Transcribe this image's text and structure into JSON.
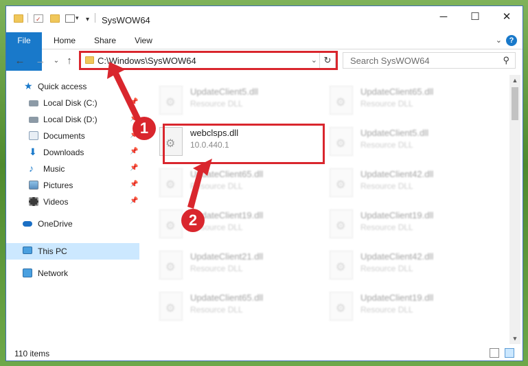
{
  "window": {
    "title": "SysWOW64"
  },
  "ribbon": {
    "tabs": [
      "File",
      "Home",
      "Share",
      "View"
    ],
    "help": "?"
  },
  "address": {
    "path": "C:\\Windows\\SysWOW64"
  },
  "search": {
    "placeholder": "Search SysWOW64"
  },
  "sidebar": {
    "items": [
      {
        "label": "Quick access",
        "pinned": false
      },
      {
        "label": "Local Disk (C:)",
        "pinned": true
      },
      {
        "label": "Local Disk (D:)",
        "pinned": true
      },
      {
        "label": "Documents",
        "pinned": true
      },
      {
        "label": "Downloads",
        "pinned": true
      },
      {
        "label": "Music",
        "pinned": true
      },
      {
        "label": "Pictures",
        "pinned": true
      },
      {
        "label": "Videos",
        "pinned": true
      },
      {
        "label": "OneDrive",
        "pinned": false
      },
      {
        "label": "This PC",
        "pinned": false,
        "selected": true
      },
      {
        "label": "Network",
        "pinned": false
      }
    ]
  },
  "files": {
    "left": [
      {
        "name": "UpdateClient5.dll",
        "type": "Resource DLL"
      },
      {
        "name": "webclsps.dll",
        "type": "10.0.440.1",
        "highlighted": true
      },
      {
        "name": "UpdateClient65.dll",
        "type": "Resource DLL"
      },
      {
        "name": "UpdateClient19.dll",
        "type": "Resource DLL"
      },
      {
        "name": "UpdateClient21.dll",
        "type": "Resource DLL"
      },
      {
        "name": "UpdateClient65.dll",
        "type": "Resource DLL"
      }
    ],
    "right": [
      {
        "name": "UpdateClient65.dll",
        "type": "Resource DLL"
      },
      {
        "name": "UpdateClient5.dll",
        "type": "Resource DLL"
      },
      {
        "name": "UpdateClient42.dll",
        "type": "Resource DLL"
      },
      {
        "name": "UpdateClient19.dll",
        "type": "Resource DLL"
      },
      {
        "name": "UpdateClient42.dll",
        "type": "Resource DLL"
      },
      {
        "name": "UpdateClient19.dll",
        "type": "Resource DLL"
      }
    ]
  },
  "status": {
    "count": "110 items"
  },
  "annotations": {
    "badge1": "1",
    "badge2": "2"
  },
  "colors": {
    "accent": "#1979ca",
    "annotation": "#d9262d",
    "selection": "#cce8ff"
  }
}
